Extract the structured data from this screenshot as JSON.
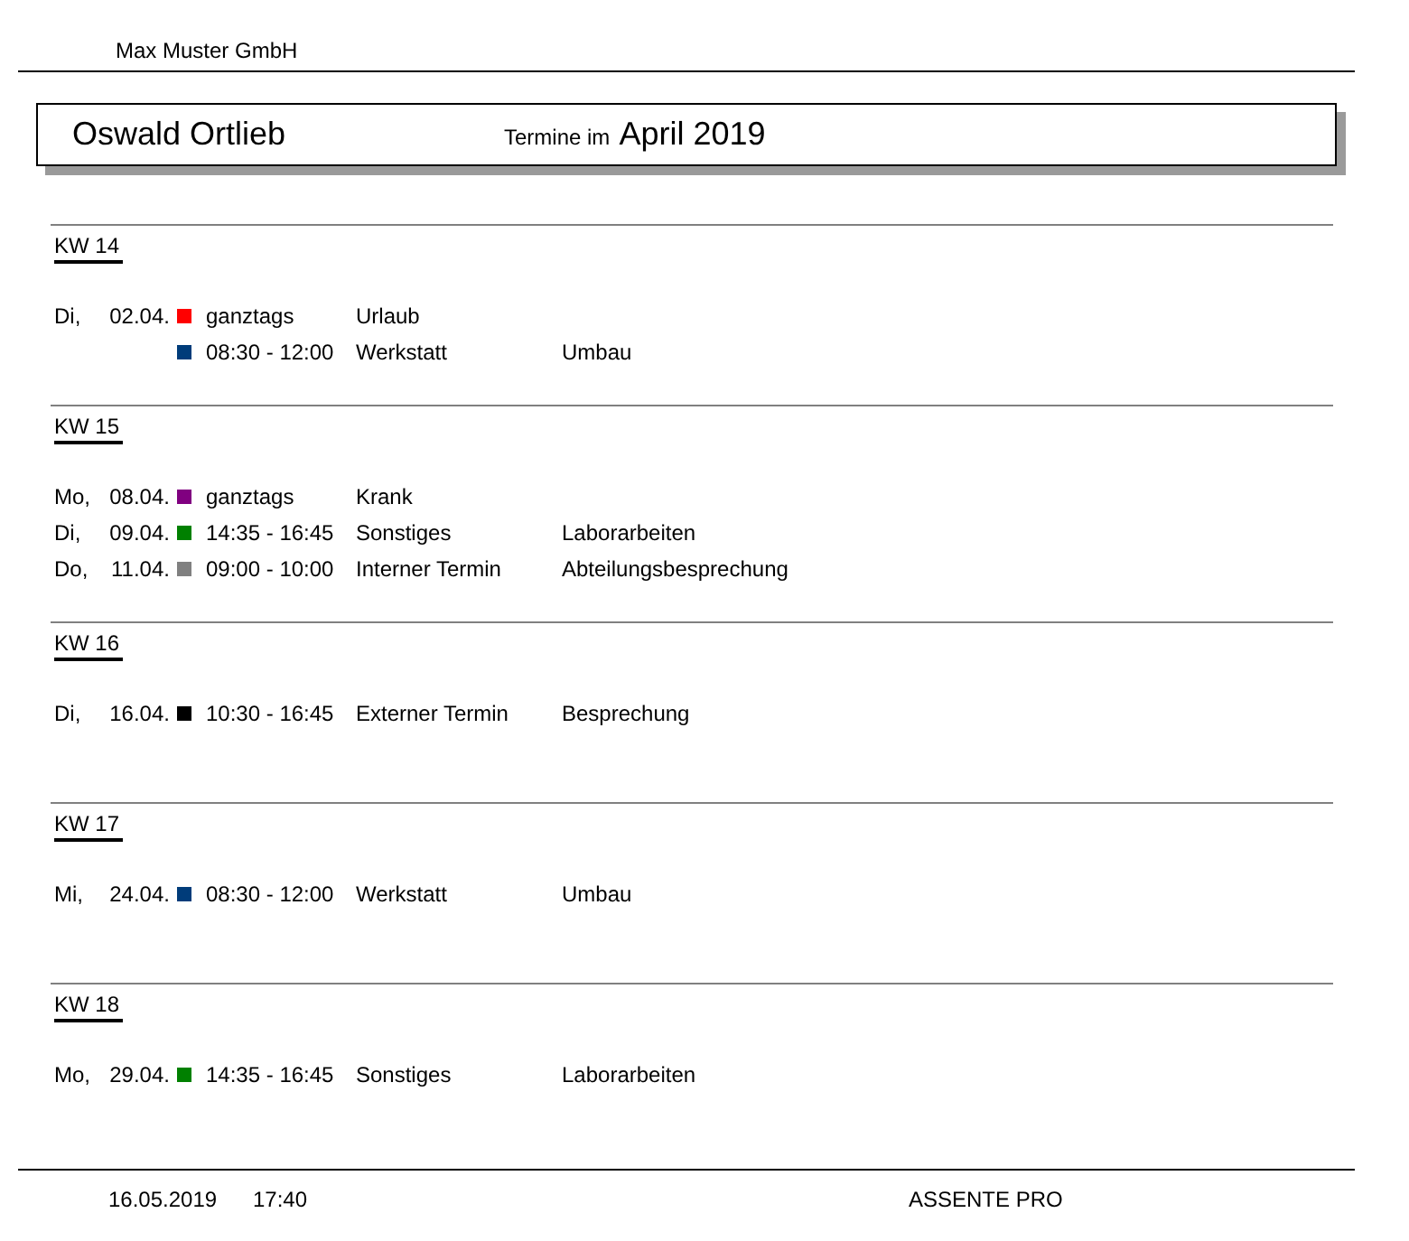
{
  "company": "Max Muster GmbH",
  "header": {
    "person": "Oswald Ortlieb",
    "caption": "Termine im",
    "period": "April 2019"
  },
  "weeks": [
    {
      "label": "KW 14",
      "entries": [
        {
          "weekday": "Di,",
          "date": "02.04.",
          "color": "#ff0000",
          "time": "ganztags",
          "type": "Urlaub"
        },
        {
          "color": "#003c7a",
          "time": "08:30 - 12:00",
          "type": "Werkstatt",
          "description": "Umbau"
        }
      ]
    },
    {
      "label": "KW 15",
      "entries": [
        {
          "weekday": "Mo,",
          "date": "08.04.",
          "color": "#800080",
          "time": "ganztags",
          "type": "Krank"
        },
        {
          "weekday": "Di,",
          "date": "09.04.",
          "color": "#008000",
          "time": "14:35 - 16:45",
          "type": "Sonstiges",
          "description": "Laborarbeiten"
        },
        {
          "weekday": "Do,",
          "date": "11.04.",
          "color": "#808080",
          "time": "09:00 - 10:00",
          "type": "Interner Termin",
          "description": "Abteilungsbesprechung"
        }
      ]
    },
    {
      "label": "KW 16",
      "entries": [
        {
          "weekday": "Di,",
          "date": "16.04.",
          "color": "#000000",
          "time": "10:30 - 16:45",
          "type": "Externer Termin",
          "description": "Besprechung"
        }
      ]
    },
    {
      "label": "KW 17",
      "entries": [
        {
          "weekday": "Mi,",
          "date": "24.04.",
          "color": "#003c7a",
          "time": "08:30 - 12:00",
          "type": "Werkstatt",
          "description": "Umbau"
        }
      ]
    },
    {
      "label": "KW 18",
      "entries": [
        {
          "weekday": "Mo,",
          "date": "29.04.",
          "color": "#008000",
          "time": "14:35 - 16:45",
          "type": "Sonstiges",
          "description": "Laborarbeiten"
        }
      ]
    }
  ],
  "footer": {
    "date": "16.05.2019",
    "time": "17:40",
    "product": "ASSENTE PRO"
  }
}
